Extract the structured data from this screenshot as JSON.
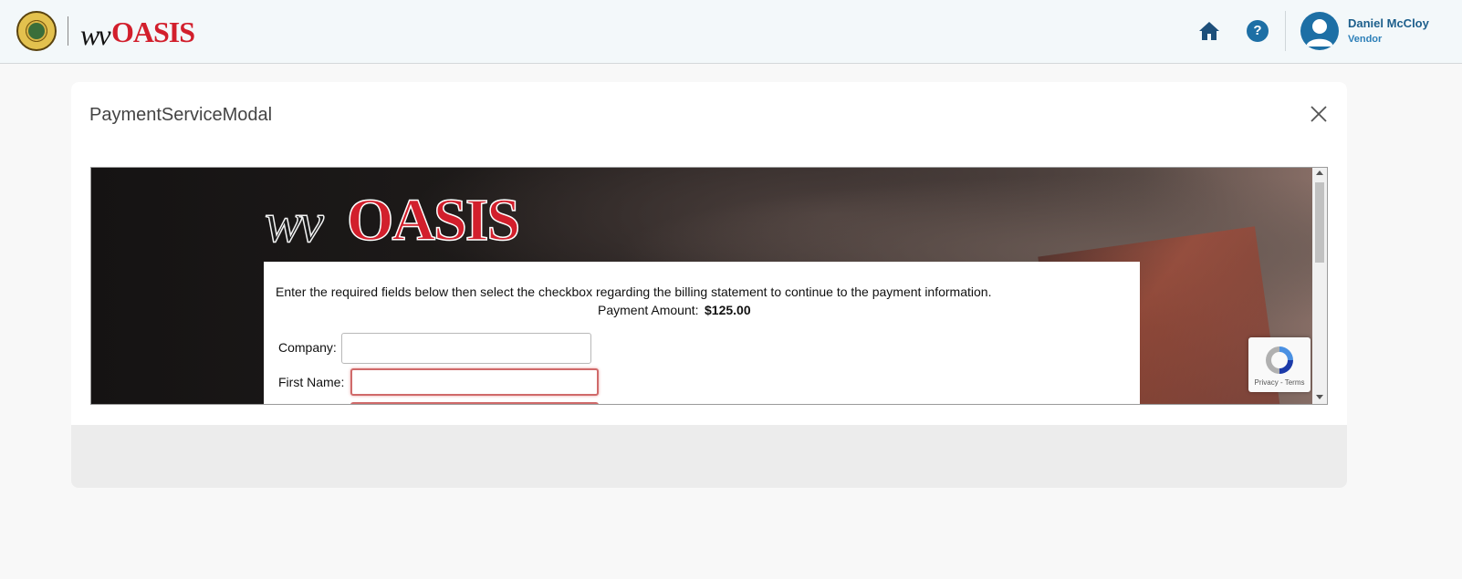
{
  "header": {
    "brand_wv": "wv",
    "brand_oasis": "OASIS",
    "user_name": "Daniel McCloy",
    "user_role": "Vendor",
    "help_label": "?"
  },
  "modal": {
    "title": "PaymentServiceModal",
    "iframe": {
      "logo_wv": "wv",
      "logo_oasis": "OASIS",
      "instructions": "Enter the required fields below then select the checkbox regarding the billing statement to continue to the payment information.",
      "amount_label": "Payment Amount:",
      "amount_value": "$125.00",
      "fields": {
        "company_label": "Company:",
        "company_value": "",
        "first_name_label": "First Name:",
        "first_name_value": ""
      },
      "recaptcha_text": "Privacy - Terms"
    }
  },
  "colors": {
    "brand_red": "#d21f2c",
    "accent_blue": "#1d6fa5",
    "error_border": "#d06a6a"
  },
  "icons": [
    "state-seal-icon",
    "home-icon",
    "help-icon",
    "user-avatar-icon",
    "close-icon",
    "recaptcha-icon"
  ]
}
